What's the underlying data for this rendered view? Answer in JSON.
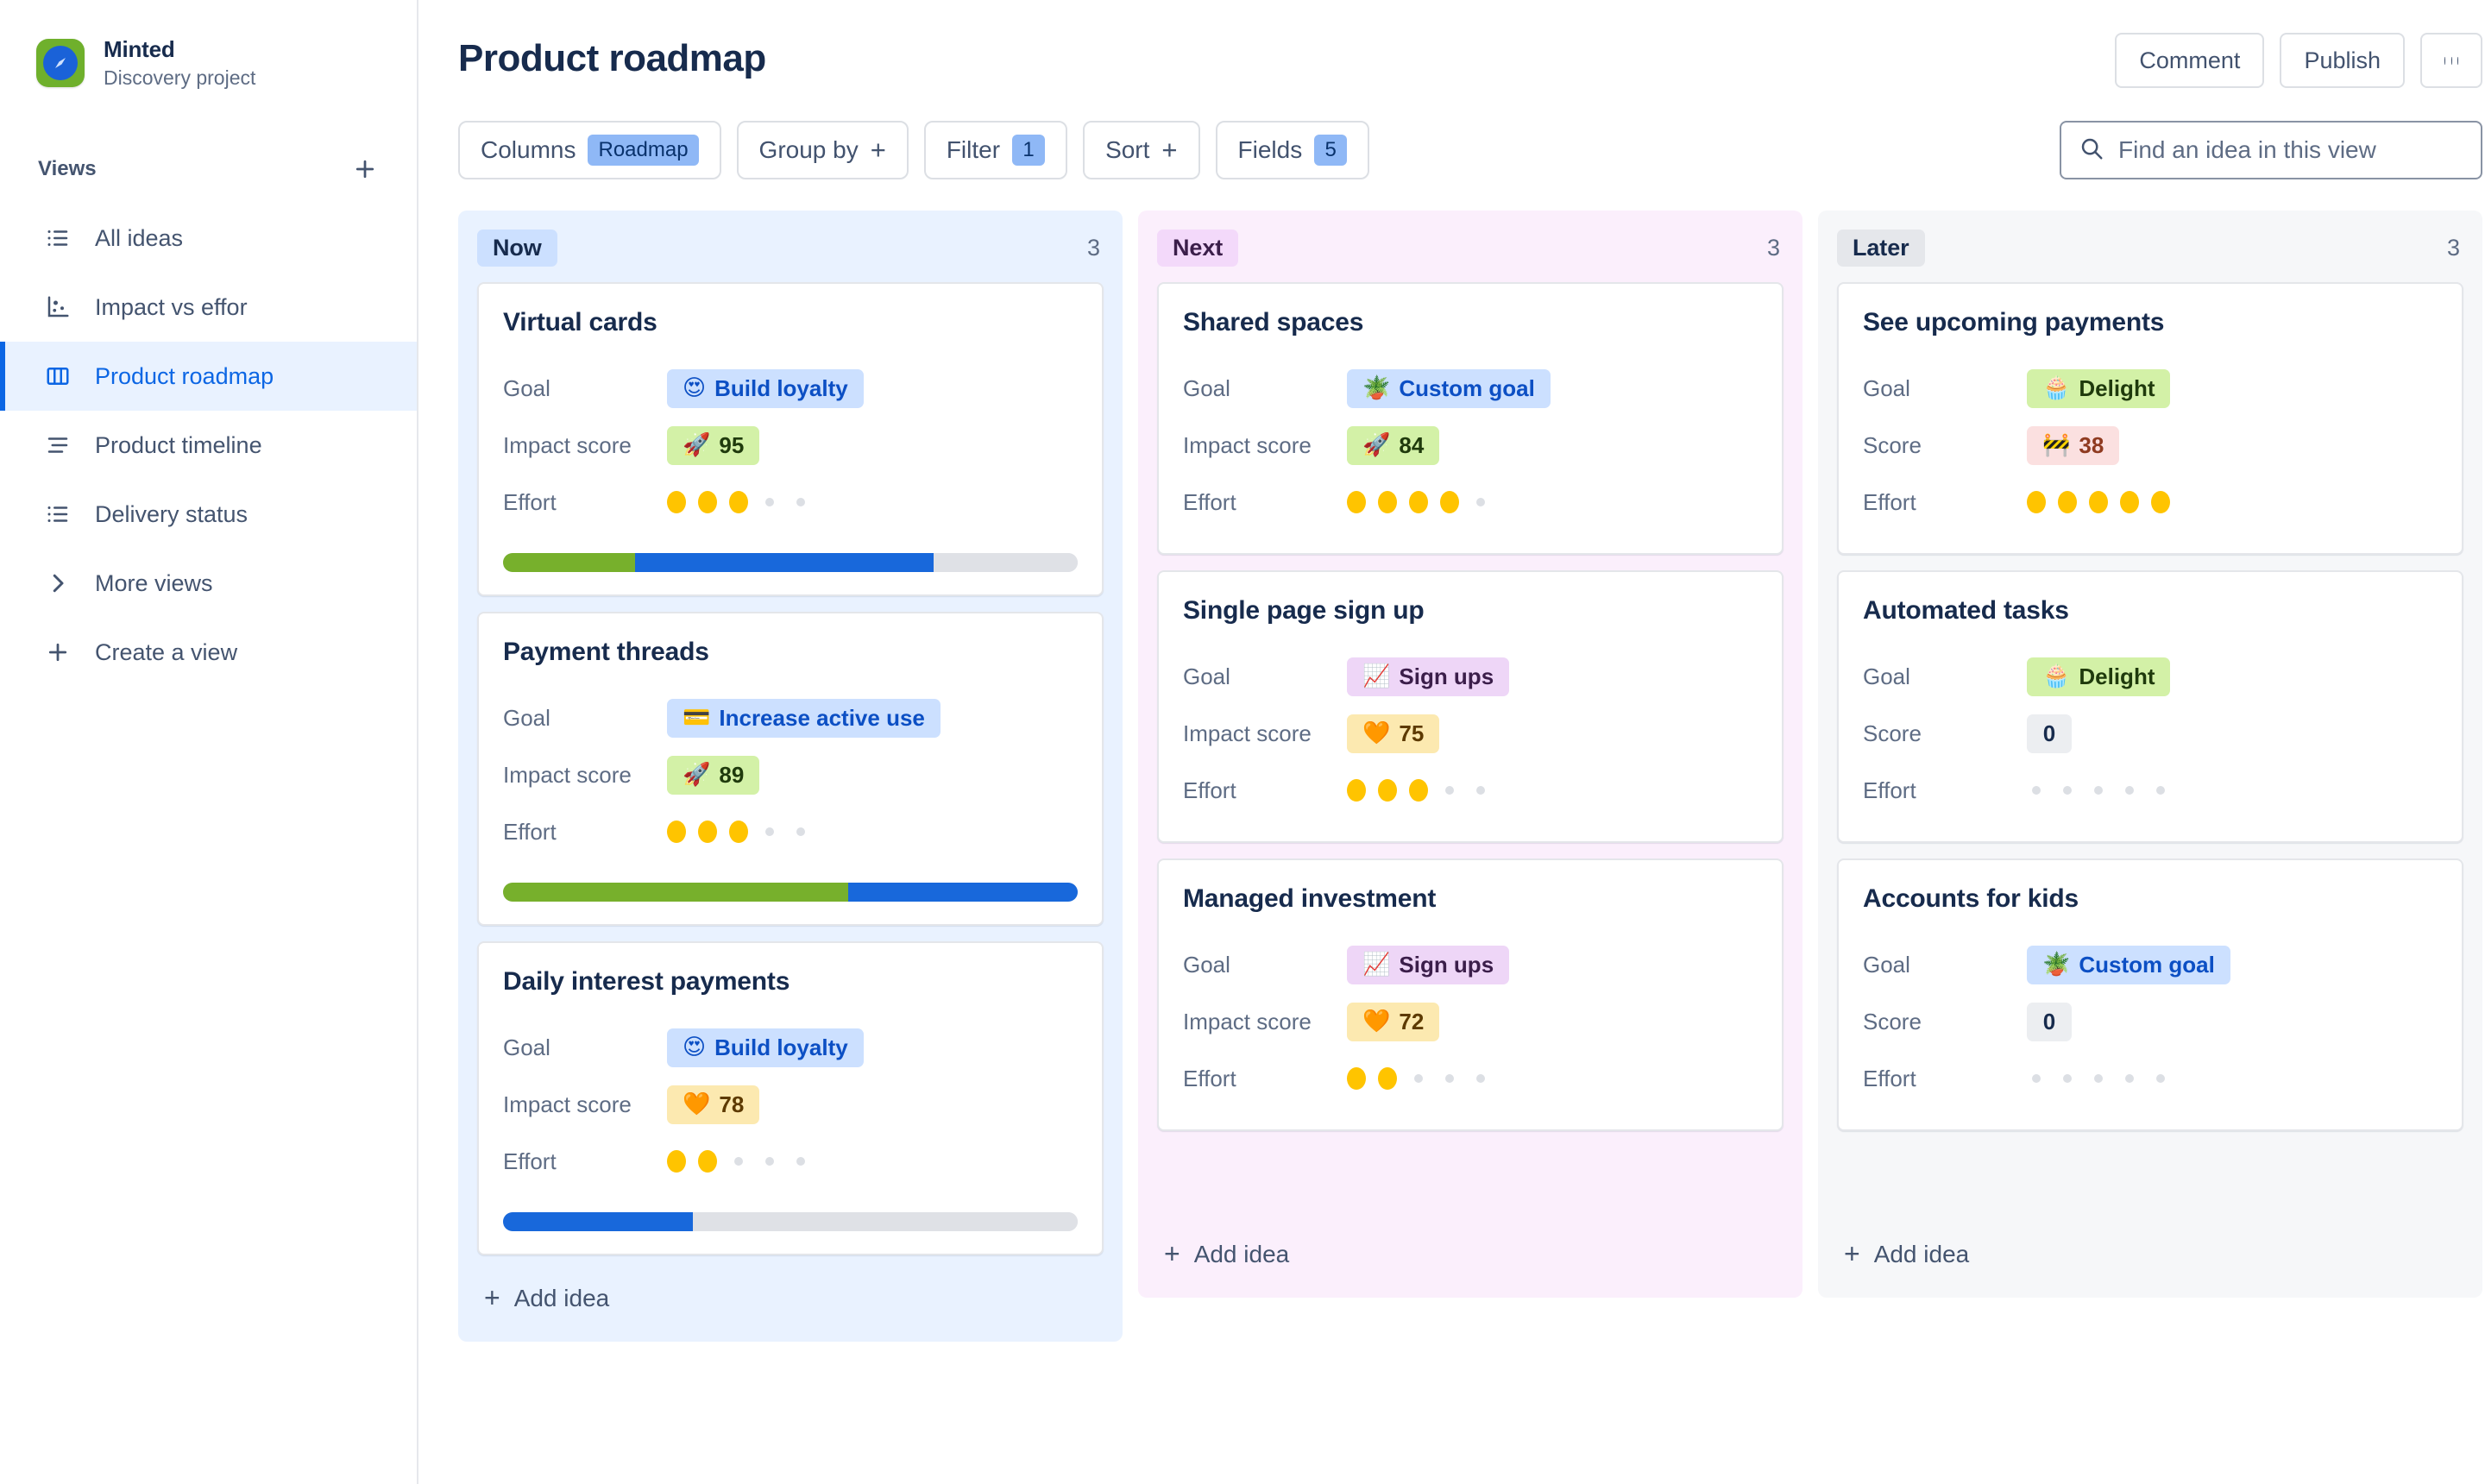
{
  "sidebar": {
    "brand": {
      "name": "Minted",
      "subtitle": "Discovery project",
      "logo_icon": "compass-icon"
    },
    "views_heading": "Views",
    "add_view_icon": "plus-icon",
    "items": [
      {
        "label": "All ideas",
        "icon": "list-icon",
        "active": false
      },
      {
        "label": "Impact vs effor",
        "icon": "scatter-icon",
        "active": false
      },
      {
        "label": "Product roadmap",
        "icon": "board-icon",
        "active": true
      },
      {
        "label": "Product timeline",
        "icon": "timeline-icon",
        "active": false
      },
      {
        "label": "Delivery status",
        "icon": "list-icon",
        "active": false
      },
      {
        "label": "More views",
        "icon": "chevron-right-icon",
        "active": false
      },
      {
        "label": "Create a view",
        "icon": "plus-icon",
        "active": false
      }
    ]
  },
  "header": {
    "title": "Product roadmap",
    "comment_label": "Comment",
    "publish_label": "Publish",
    "more_icon": "ellipsis-icon"
  },
  "toolbar": {
    "columns_label": "Columns",
    "columns_value": "Roadmap",
    "group_by_label": "Group by",
    "group_by_glyph": "+",
    "filter_label": "Filter",
    "filter_count": "1",
    "sort_label": "Sort",
    "sort_glyph": "+",
    "fields_label": "Fields",
    "fields_count": "5",
    "search_placeholder": "Find an idea in this view",
    "search_value": "",
    "search_icon": "search-icon"
  },
  "board": {
    "add_idea_label": "Add idea",
    "columns": [
      {
        "id": "now",
        "title": "Now",
        "count": "3",
        "bg": "#e9f2ff",
        "pill_bg": "#cce0ff",
        "cards": [
          {
            "title": "Virtual cards",
            "goal_label": "Goal",
            "goal_emoji": "😍",
            "goal_value": "Build loyalty",
            "goal_style": "blue",
            "score_label": "Impact score",
            "score_emoji": "🚀",
            "score_value": "95",
            "score_style": "green",
            "effort_label": "Effort",
            "effort_filled": 3,
            "effort_total": 5,
            "progress": [
              {
                "color": "green",
                "pct": 23
              },
              {
                "color": "blue",
                "pct": 52
              },
              {
                "color": "grey",
                "pct": 25
              }
            ]
          },
          {
            "title": "Payment threads",
            "goal_label": "Goal",
            "goal_emoji": "💳",
            "goal_value": "Increase active use",
            "goal_style": "blue",
            "score_label": "Impact score",
            "score_emoji": "🚀",
            "score_value": "89",
            "score_style": "green",
            "effort_label": "Effort",
            "effort_filled": 3,
            "effort_total": 5,
            "progress": [
              {
                "color": "green",
                "pct": 60
              },
              {
                "color": "blue",
                "pct": 40
              }
            ]
          },
          {
            "title": "Daily interest payments",
            "goal_label": "Goal",
            "goal_emoji": "😍",
            "goal_value": "Build loyalty",
            "goal_style": "blue",
            "score_label": "Impact score",
            "score_emoji": "🧡",
            "score_value": "78",
            "score_style": "yellow",
            "effort_label": "Effort",
            "effort_filled": 2,
            "effort_total": 5,
            "progress": [
              {
                "color": "blue",
                "pct": 33
              },
              {
                "color": "grey",
                "pct": 67
              }
            ]
          }
        ]
      },
      {
        "id": "next",
        "title": "Next",
        "count": "3",
        "bg": "#fbeffc",
        "pill_bg": "#f3d9fa",
        "cards": [
          {
            "title": "Shared spaces",
            "goal_label": "Goal",
            "goal_emoji": "🪴",
            "goal_value": "Custom goal",
            "goal_style": "blue",
            "score_label": "Impact score",
            "score_emoji": "🚀",
            "score_value": "84",
            "score_style": "green",
            "effort_label": "Effort",
            "effort_filled": 4,
            "effort_total": 5,
            "progress": []
          },
          {
            "title": "Single page sign up",
            "goal_label": "Goal",
            "goal_emoji": "📈",
            "goal_value": "Sign ups",
            "goal_style": "purple",
            "score_label": "Impact score",
            "score_emoji": "🧡",
            "score_value": "75",
            "score_style": "yellow",
            "effort_label": "Effort",
            "effort_filled": 3,
            "effort_total": 5,
            "progress": []
          },
          {
            "title": "Managed investment",
            "goal_label": "Goal",
            "goal_emoji": "📈",
            "goal_value": "Sign ups",
            "goal_style": "purple",
            "score_label": "Impact score",
            "score_emoji": "🧡",
            "score_value": "72",
            "score_style": "yellow",
            "effort_label": "Effort",
            "effort_filled": 2,
            "effort_total": 5,
            "progress": []
          }
        ]
      },
      {
        "id": "later",
        "title": "Later",
        "count": "3",
        "bg": "#f6f7f9",
        "pill_bg": "#e5e7eb",
        "cards": [
          {
            "title": "See upcoming payments",
            "goal_label": "Goal",
            "goal_emoji": "🧁",
            "goal_value": "Delight",
            "goal_style": "green",
            "score_label": "Score",
            "score_emoji": "🚧",
            "score_value": "38",
            "score_style": "red",
            "effort_label": "Effort",
            "effort_filled": 5,
            "effort_total": 5,
            "progress": []
          },
          {
            "title": "Automated tasks",
            "goal_label": "Goal",
            "goal_emoji": "🧁",
            "goal_value": "Delight",
            "goal_style": "green",
            "score_label": "Score",
            "score_emoji": "",
            "score_value": "0",
            "score_style": "grey",
            "effort_label": "Effort",
            "effort_filled": 0,
            "effort_total": 5,
            "progress": []
          },
          {
            "title": "Accounts for kids",
            "goal_label": "Goal",
            "goal_emoji": "🪴",
            "goal_value": "Custom goal",
            "goal_style": "blue",
            "score_label": "Score",
            "score_emoji": "",
            "score_value": "0",
            "score_style": "grey",
            "effort_label": "Effort",
            "effort_filled": 0,
            "effort_total": 5,
            "progress": []
          }
        ]
      }
    ]
  },
  "colors": {
    "accent": "#0c66e4",
    "progress_green": "#77b02c",
    "progress_blue": "#1868db",
    "progress_grey": "#dfe1e6",
    "effort_pip": "#ffc400"
  }
}
